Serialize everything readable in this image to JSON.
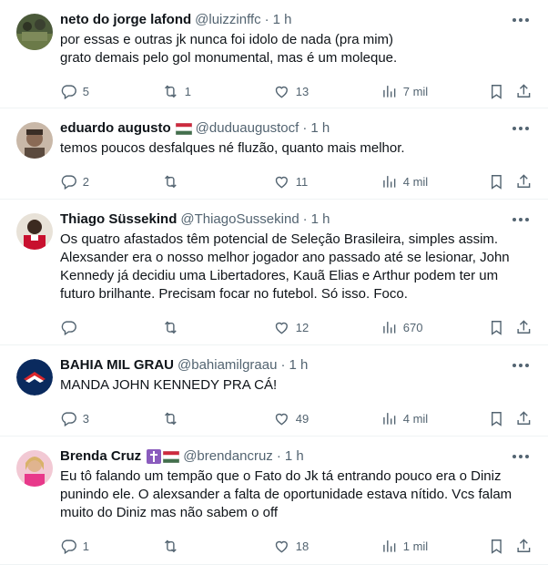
{
  "tweets": [
    {
      "name": "neto do jorge lafond",
      "handle": "@luizzinffc",
      "time": "1 h",
      "flag": false,
      "badge": false,
      "lines": [
        "por essas e outras jk nunca foi idolo de nada (pra mim)",
        "grato demais pelo gol monumental, mas é um moleque."
      ],
      "replies": "5",
      "retweets": "1",
      "likes": "13",
      "views": "7 mil"
    },
    {
      "name": "eduardo augusto",
      "handle": "@duduaugustocf",
      "time": "1 h",
      "flag": true,
      "badge": false,
      "lines": [
        "temos poucos desfalques né fluzão, quanto mais melhor."
      ],
      "replies": "2",
      "retweets": "",
      "likes": "11",
      "views": "4 mil"
    },
    {
      "name": "Thiago Süssekind",
      "handle": "@ThiagoSussekind",
      "time": "1 h",
      "flag": false,
      "badge": false,
      "lines": [
        "Os quatro afastados têm potencial de Seleção Brasileira, simples assim.",
        "Alexsander era o nosso melhor jogador ano passado até se lesionar, John",
        "Kennedy já decidiu uma Libertadores, Kauã Elias e Arthur podem ter um",
        "futuro brilhante. Precisam focar no futebol. Só isso. Foco."
      ],
      "replies": "",
      "retweets": "",
      "likes": "12",
      "views": "670"
    },
    {
      "name": "BAHIA MIL GRAU",
      "handle": "@bahiamilgraau",
      "time": "1 h",
      "flag": false,
      "badge": false,
      "lines": [
        "MANDA JOHN KENNEDY PRA CÁ!"
      ],
      "replies": "3",
      "retweets": "",
      "likes": "49",
      "views": "4 mil"
    },
    {
      "name": "Brenda Cruz",
      "handle": "@brendancruz",
      "time": "1 h",
      "flag": true,
      "badge": true,
      "lines": [
        "Eu tô falando um tempão que o Fato do Jk tá entrando pouco era o Diniz",
        "punindo ele. O alexsander a falta de oportunidade estava nítido.  Vcs falam",
        "muito do Diniz mas não sabem o off"
      ],
      "replies": "1",
      "retweets": "",
      "likes": "18",
      "views": "1 mil"
    }
  ],
  "colors": {
    "text": "#0f1419",
    "muted": "#536471",
    "border": "#eff3f4"
  }
}
